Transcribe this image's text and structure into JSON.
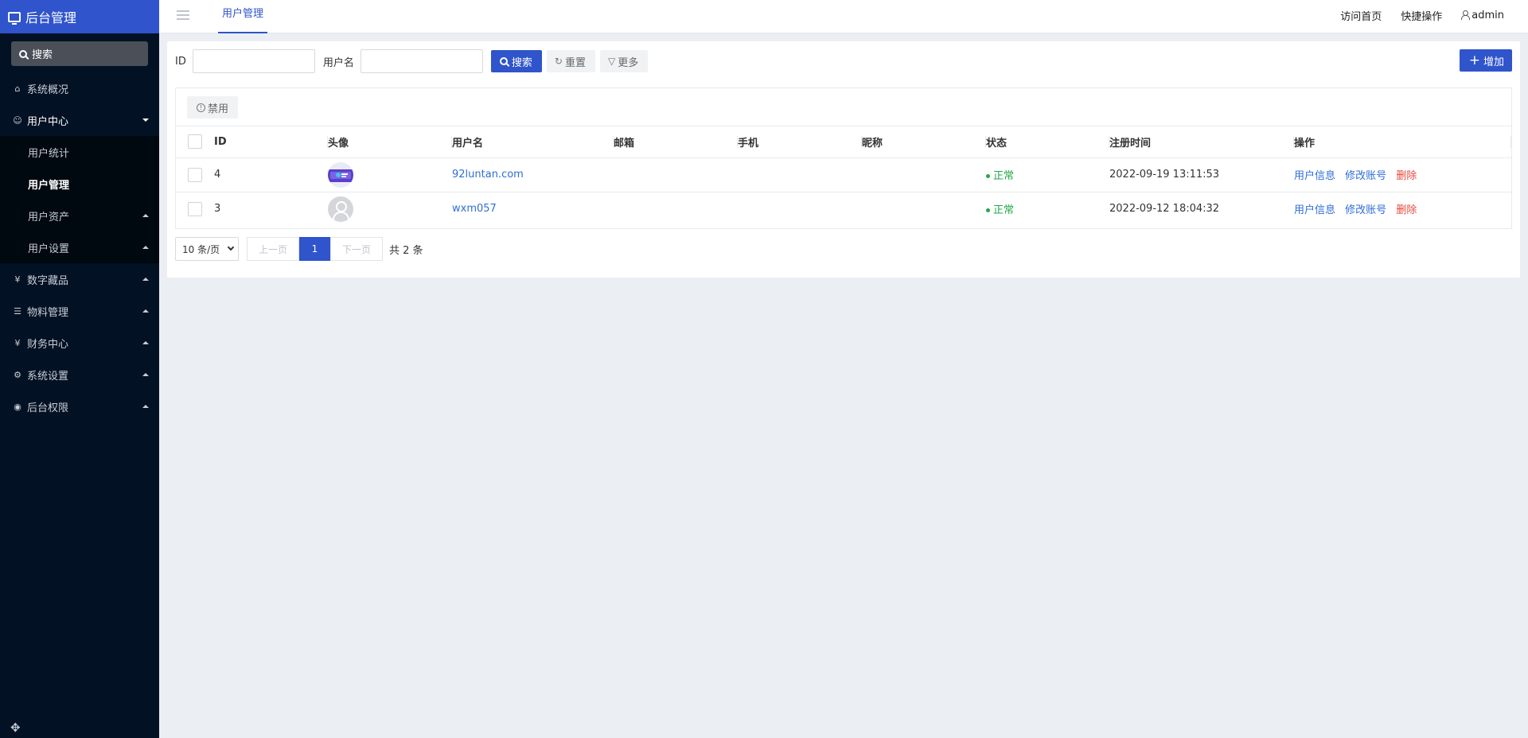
{
  "brand": {
    "title": "后台管理"
  },
  "sidebar": {
    "search_label": "搜索",
    "items": [
      {
        "label": "系统概况",
        "icon": "home-icon"
      },
      {
        "label": "用户中心",
        "icon": "users-icon",
        "open": true
      },
      {
        "label": "数字藏品",
        "icon": "yen-icon"
      },
      {
        "label": "物料管理",
        "icon": "list-icon"
      },
      {
        "label": "财务中心",
        "icon": "yen-icon"
      },
      {
        "label": "系统设置",
        "icon": "gear-icon"
      },
      {
        "label": "后台权限",
        "icon": "user-circle-icon"
      }
    ],
    "sub_items": [
      {
        "label": "用户统计"
      },
      {
        "label": "用户管理",
        "active": true
      },
      {
        "label": "用户资产"
      },
      {
        "label": "用户设置"
      }
    ]
  },
  "topbar": {
    "tab": "用户管理",
    "links": [
      "访问首页",
      "快捷操作"
    ],
    "user": "admin"
  },
  "filter": {
    "id_label": "ID",
    "username_label": "用户名",
    "search_btn": "搜索",
    "reset_btn": "重置",
    "more_btn": "更多",
    "add_btn": "增加"
  },
  "toolbar": {
    "disable_btn": "禁用"
  },
  "table": {
    "headers": [
      "ID",
      "头像",
      "用户名",
      "邮箱",
      "手机",
      "昵称",
      "状态",
      "注册时间",
      "操作"
    ],
    "rows": [
      {
        "id": "4",
        "avatar": "image",
        "username": "92luntan.com",
        "email": "",
        "phone": "",
        "nickname": "",
        "status": "正常",
        "registered": "2022-09-19 13:11:53"
      },
      {
        "id": "3",
        "avatar": "default",
        "username": "wxm057",
        "email": "",
        "phone": "",
        "nickname": "",
        "status": "正常",
        "registered": "2022-09-12 18:04:32"
      }
    ],
    "actions": [
      "用户信息",
      "修改账号",
      "删除"
    ]
  },
  "pager": {
    "page_size": "10 条/页",
    "prev": "上一页",
    "current": "1",
    "next": "下一页",
    "total": "共 2 条"
  },
  "colors": {
    "primary": "#2f54cb",
    "sidebar_bg": "#021124",
    "success": "#23a84a",
    "danger": "#e5483c",
    "link": "#2f6ed8"
  }
}
